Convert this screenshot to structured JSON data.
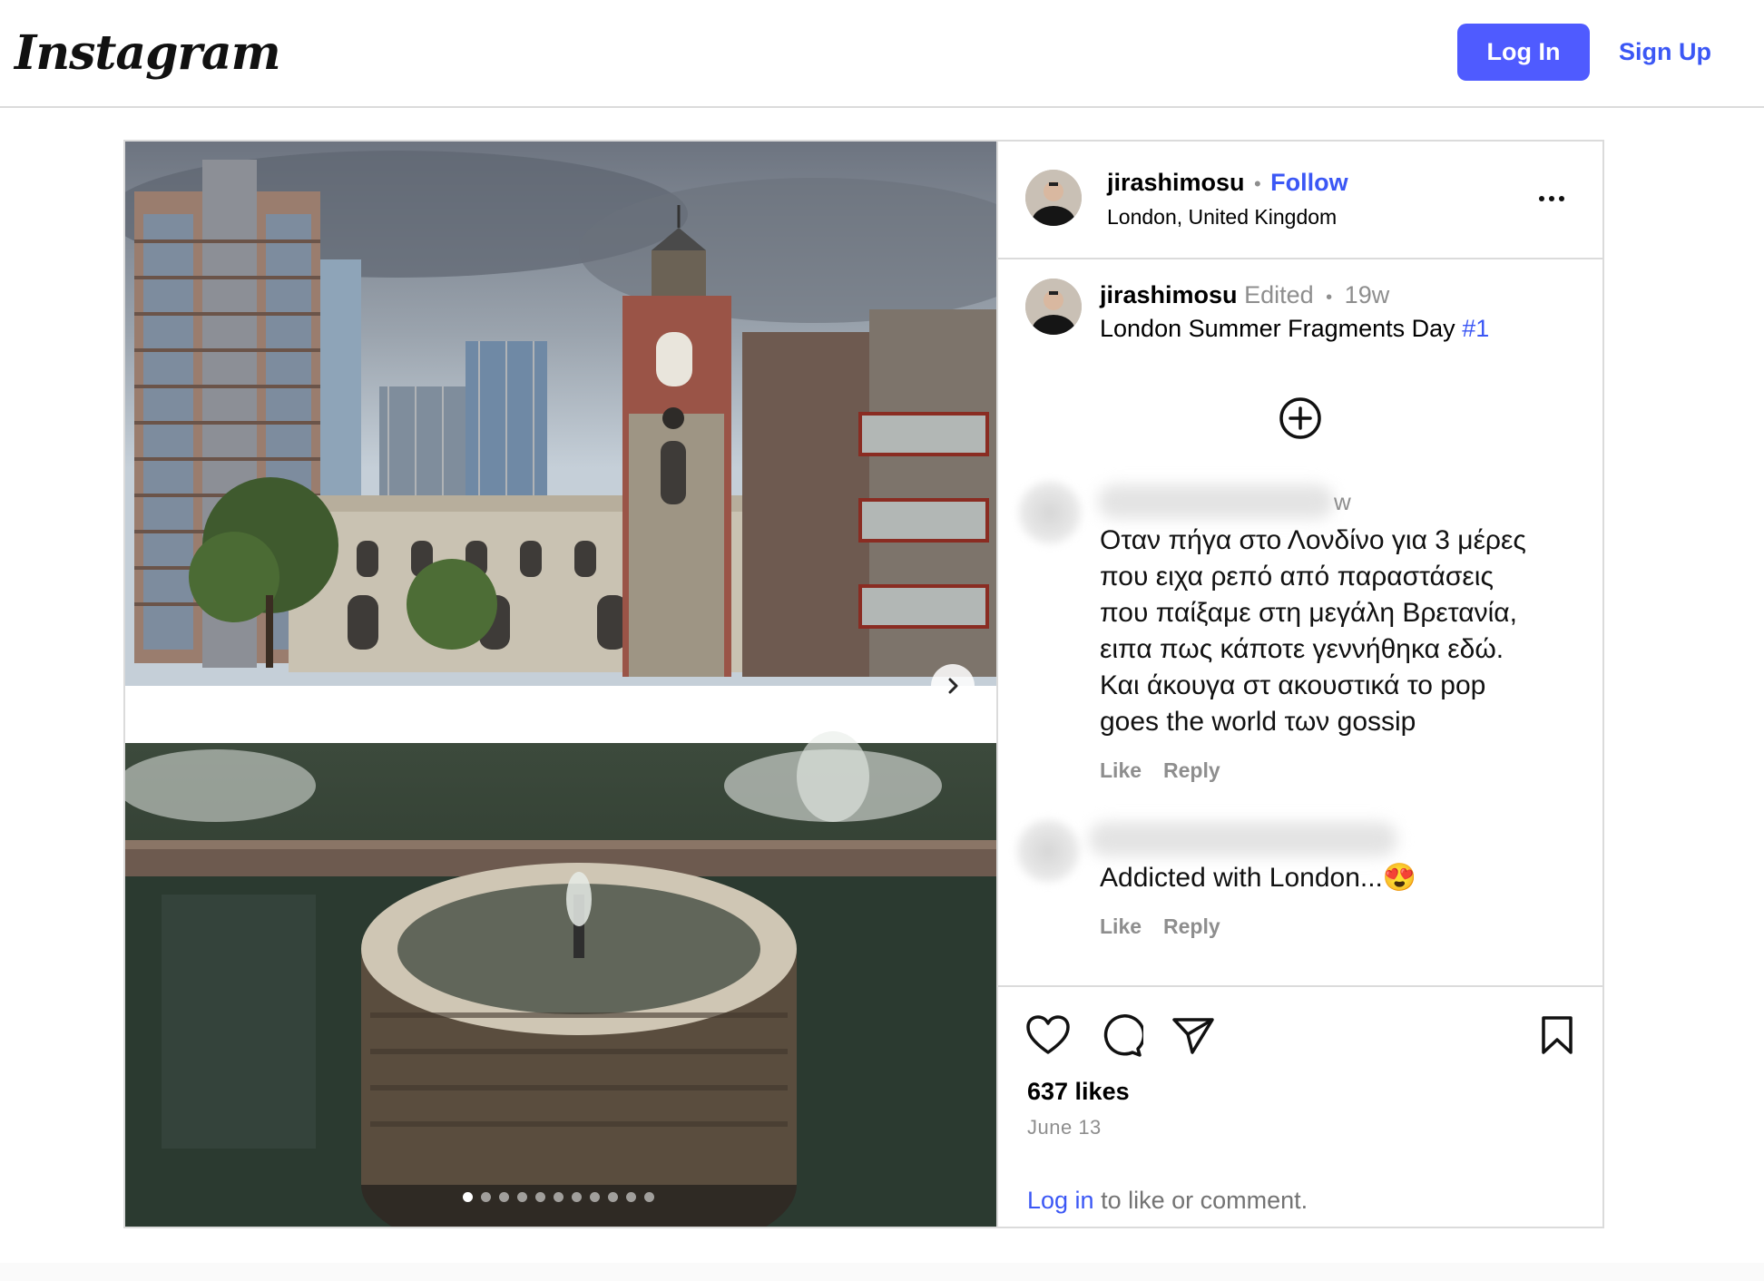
{
  "header": {
    "logo": "Instagram",
    "login_label": "Log In",
    "signup_label": "Sign Up"
  },
  "post": {
    "author": "jirashimosu",
    "follow_label": "Follow",
    "location": "London, United Kingdom",
    "caption": {
      "author": "jirashimosu",
      "edited_label": "Edited",
      "age": "19w",
      "text": "London Summer Fragments Day",
      "hashtag": "#1"
    },
    "comments": [
      {
        "age_fragment": "w",
        "lines": [
          "Οταν πήγα στο Λονδίνο για 3 μέρες",
          "που ειχα ρεπό από παραστάσεις",
          "που παίξαμε στη μεγάλη Βρετανία,",
          "ειπα πως κάποτε γεννήθηκα εδώ.",
          "Και άκουγα στ ακουστικά το pop",
          "goes the world των gossip"
        ],
        "like_label": "Like",
        "reply_label": "Reply"
      },
      {
        "text": "Addicted with London...😍",
        "like_label": "Like",
        "reply_label": "Reply"
      }
    ],
    "likes": "637 likes",
    "date": "June 13",
    "login_prompt": {
      "link": "Log in",
      "rest": " to like or comment."
    },
    "carousel_count": 11,
    "carousel_active": 1
  },
  "colors": {
    "accent": "#4f5bff",
    "link": "#3b57f5",
    "muted": "#8e8e8e",
    "border": "#dbdbdb"
  },
  "icons": [
    "heart-icon",
    "comment-icon",
    "share-icon",
    "bookmark-icon",
    "more-options-icon",
    "add-comment-icon",
    "chevron-right-icon"
  ]
}
